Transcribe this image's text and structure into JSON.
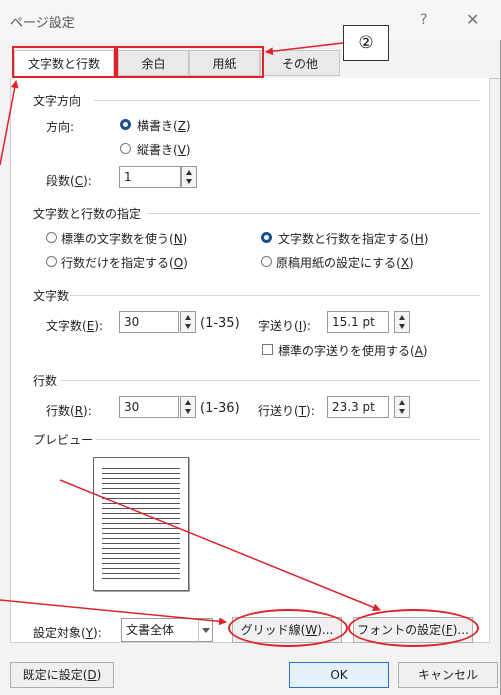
{
  "window": {
    "title": "ページ設定",
    "help_glyph": "?",
    "close_glyph": "✕"
  },
  "tabs": [
    {
      "label": "文字数と行数"
    },
    {
      "label": "余白"
    },
    {
      "label": "用紙"
    },
    {
      "label": "その他"
    }
  ],
  "text_direction": {
    "section": "文字方向",
    "direction_label": "方向:",
    "horizontal": {
      "text": "横書き(",
      "key": "Z",
      "end": ")",
      "selected": true
    },
    "vertical": {
      "text": "縦書き(",
      "key": "V",
      "end": ")",
      "selected": false
    },
    "columns_label": {
      "text": "段数(",
      "key": "C",
      "end": "):"
    },
    "columns_value": "1"
  },
  "grid_spec": {
    "section": "文字数と行数の指定",
    "opt_standard": {
      "text": "標準の文字数を使う(",
      "key": "N",
      "end": ")",
      "selected": false
    },
    "opt_chars_lines": {
      "text": "文字数と行数を指定する(",
      "key": "H",
      "end": ")",
      "selected": true
    },
    "opt_lines_only": {
      "text": "行数だけを指定する(",
      "key": "O",
      "end": ")",
      "selected": false
    },
    "opt_manuscript": {
      "text": "原稿用紙の設定にする(",
      "key": "X",
      "end": ")",
      "selected": false
    }
  },
  "chars": {
    "section": "文字数",
    "count_label": {
      "text": "文字数(",
      "key": "E",
      "end": "):"
    },
    "count_value": "30",
    "range": "(1-35)",
    "pitch_label": {
      "text": "字送り(",
      "key": "I",
      "end": "):"
    },
    "pitch_value": "15.1 pt",
    "default_pitch": {
      "text": "標準の字送りを使用する(",
      "key": "A",
      "end": ")",
      "checked": false
    }
  },
  "lines": {
    "section": "行数",
    "count_label": {
      "text": "行数(",
      "key": "R",
      "end": "):"
    },
    "count_value": "30",
    "range": "(1-36)",
    "pitch_label": {
      "text": "行送り(",
      "key": "T",
      "end": "):"
    },
    "pitch_value": "23.3 pt"
  },
  "preview": {
    "section": "プレビュー"
  },
  "apply_to": {
    "label": {
      "text": "設定対象(",
      "key": "Y",
      "end": "):"
    },
    "value": "文書全体"
  },
  "buttons": {
    "grid": {
      "text": "グリッド線(",
      "key": "W",
      "end": ")..."
    },
    "font": {
      "text": "フォントの設定(",
      "key": "F",
      "end": ")..."
    },
    "set_default": {
      "text": "既定に設定(",
      "key": "D",
      "end": ")"
    },
    "ok": "OK",
    "cancel": "キャンセル"
  },
  "annotation": {
    "callout": "②",
    "color": "#e0232b"
  },
  "colors": {
    "accent": "#1a4f8f",
    "annotation": "#e0232b",
    "default_button_border": "#2a72c8"
  }
}
